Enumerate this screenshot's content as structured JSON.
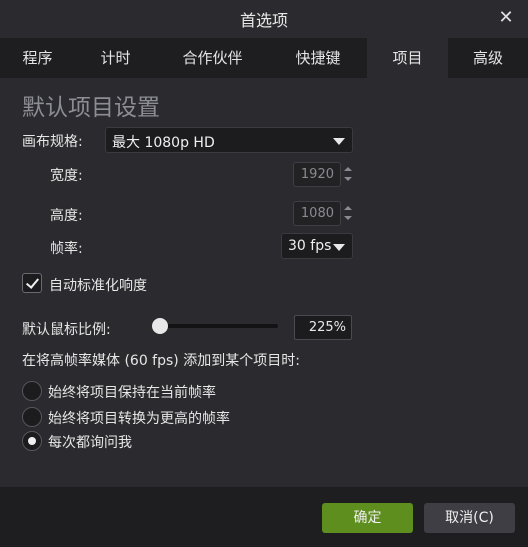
{
  "window": {
    "title": "首选项"
  },
  "tabs": [
    {
      "label": "程序"
    },
    {
      "label": "计时"
    },
    {
      "label": "合作伙伴"
    },
    {
      "label": "快捷键"
    },
    {
      "label": "项目",
      "active": true
    },
    {
      "label": "高级"
    }
  ],
  "section": {
    "heading": "默认项目设置"
  },
  "canvas": {
    "label": "画布规格:",
    "selected": "最大 1080p HD",
    "width_label": "宽度:",
    "width_value": "1920",
    "height_label": "高度:",
    "height_value": "1080",
    "fps_label": "帧率:",
    "fps_value": "30 fps"
  },
  "auto_normalize": {
    "label": "自动标准化响度",
    "checked": true
  },
  "cursor_scale": {
    "label": "默认鼠标比例:",
    "value_text": "225%",
    "slider_level": 0.0
  },
  "high_fps": {
    "prompt": "在将高帧率媒体 (60 fps) 添加到某个项目时:",
    "options": [
      {
        "label": "始终将项目保持在当前帧率",
        "checked": false
      },
      {
        "label": "始终将项目转换为更高的帧率",
        "checked": false
      },
      {
        "label": "每次都询问我",
        "checked": true
      }
    ]
  },
  "buttons": {
    "ok": "确定",
    "cancel": "取消(C)"
  },
  "colors": {
    "accent_ok": "#5e8e1e",
    "background": "#2b2b2f",
    "tabbar": "#1e1e21"
  }
}
